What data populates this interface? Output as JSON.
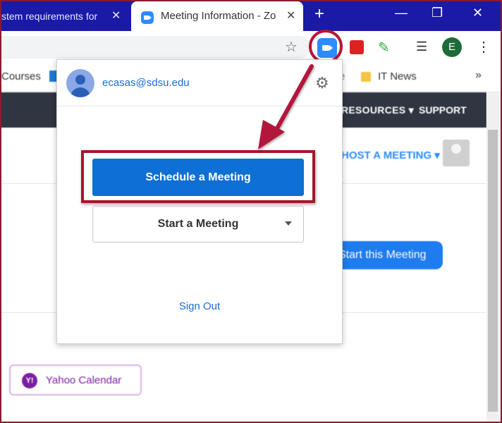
{
  "browser": {
    "tabs": [
      {
        "title": "stem requirements for"
      },
      {
        "title": "Meeting Information - Zo"
      }
    ],
    "new_tab": "+",
    "close_glyph": "✕",
    "window_controls": [
      "—",
      "❐",
      "✕"
    ],
    "profile_initial": "E"
  },
  "bookmarks": [
    {
      "label": "Courses"
    },
    {
      "label": "e"
    },
    {
      "label": "IT News"
    },
    {
      "label": "»"
    }
  ],
  "page": {
    "nav": [
      "RESOURCES ▾",
      "SUPPORT"
    ],
    "host_meeting": "HOST A MEETING ▾",
    "start_this_meeting": "Start this Meeting",
    "yahoo_icon": "Y!",
    "yahoo_calendar": "Yahoo Calendar"
  },
  "popup": {
    "email": "ecasas@sdsu.edu",
    "schedule_label": "Schedule a Meeting",
    "start_label": "Start a Meeting",
    "signout_label": "Sign Out"
  },
  "colors": {
    "tabstrip": "#1a1aa6",
    "zoom_blue": "#2d8cff",
    "annotation_red": "#a6162e",
    "schedule_button": "#0e6fd4"
  },
  "icons": [
    "star-icon",
    "zoom-extension-icon",
    "gear-icon",
    "kebab-menu-icon",
    "avatar-icon",
    "chevron-down-icon"
  ]
}
